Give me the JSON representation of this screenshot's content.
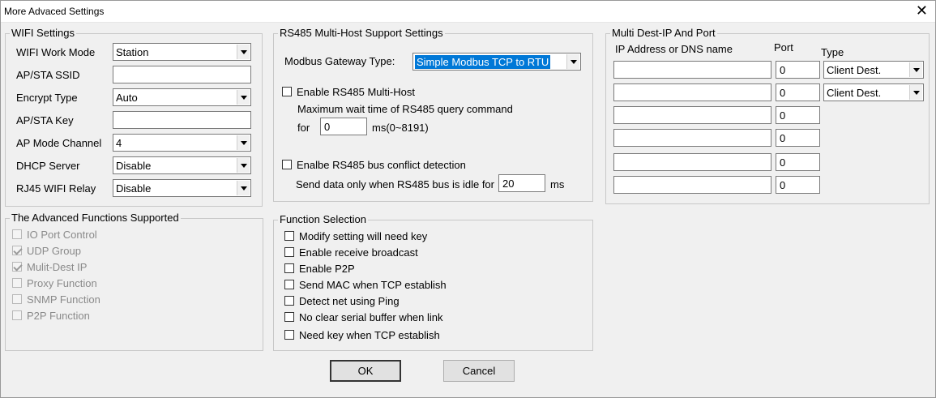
{
  "window": {
    "title": "More Advaced Settings",
    "close_glyph": "✕"
  },
  "wifi": {
    "legend": "WIFI Settings",
    "rows": [
      {
        "label": "WIFI Work Mode",
        "type": "combo",
        "value": "Station"
      },
      {
        "label": "AP/STA SSID",
        "type": "text",
        "value": ""
      },
      {
        "label": "Encrypt Type",
        "type": "combo",
        "value": "Auto"
      },
      {
        "label": "AP/STA Key",
        "type": "text",
        "value": ""
      },
      {
        "label": "AP Mode Channel",
        "type": "combo",
        "value": "4"
      },
      {
        "label": "DHCP Server",
        "type": "combo",
        "value": "Disable"
      },
      {
        "label": "RJ45 WIFI Relay",
        "type": "combo",
        "value": "Disable"
      }
    ]
  },
  "rs485": {
    "legend": "RS485 Multi-Host Support Settings",
    "gateway_label": "Modbus Gateway Type:",
    "gateway_value": "Simple Modbus TCP to RTU",
    "multihost_label": "Enable RS485 Multi-Host",
    "wait_text": "Maximum wait time of RS485  query command",
    "for_label": "for",
    "wait_value": "0",
    "wait_unit": "ms(0~8191)",
    "conflict_label": "Enalbe RS485 bus conflict detection",
    "idle_text": "Send data only when RS485 bus is idle for",
    "idle_value": "20",
    "idle_unit": "ms"
  },
  "multidest": {
    "legend": "Multi Dest-IP And Port",
    "col_ip": "IP Address or DNS name",
    "col_port": "Port",
    "col_type": "Type",
    "rows": [
      {
        "ip": "",
        "port": "0",
        "type": "Client Dest."
      },
      {
        "ip": "",
        "port": "0",
        "type": "Client Dest."
      },
      {
        "ip": "",
        "port": "0"
      },
      {
        "ip": "",
        "port": "0"
      },
      {
        "ip": "",
        "port": "0"
      },
      {
        "ip": "",
        "port": "0"
      }
    ]
  },
  "advanced": {
    "legend": "The Advanced Functions Supported",
    "items": [
      {
        "label": "IO Port Control",
        "checked": false
      },
      {
        "label": "UDP Group",
        "checked": true
      },
      {
        "label": "Mulit-Dest IP",
        "checked": true
      },
      {
        "label": "Proxy Function",
        "checked": false
      },
      {
        "label": "SNMP Function",
        "checked": false
      },
      {
        "label": "P2P Function",
        "checked": false
      }
    ]
  },
  "functions": {
    "legend": "Function Selection",
    "items": [
      {
        "label": "Modify setting will need key"
      },
      {
        "label": "Enable receive broadcast"
      },
      {
        "label": "Enable P2P"
      },
      {
        "label": "Send MAC when TCP establish"
      },
      {
        "label": "Detect net using Ping"
      },
      {
        "label": "No clear serial buffer when link"
      },
      {
        "label": "Need key when TCP establish"
      }
    ]
  },
  "buttons": {
    "ok": "OK",
    "cancel": "Cancel"
  }
}
